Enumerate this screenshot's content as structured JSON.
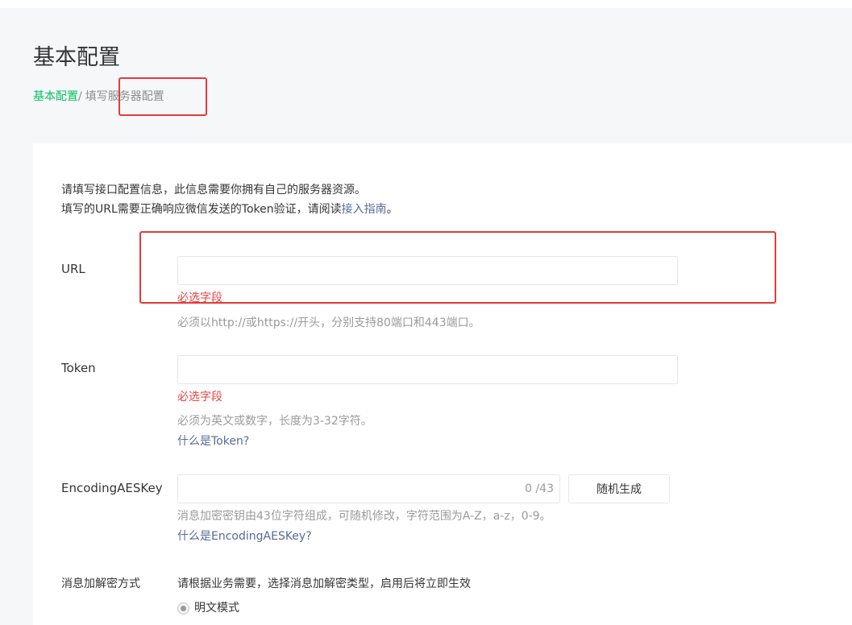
{
  "page": {
    "title": "基本配置",
    "breadcrumb": {
      "home": "基本配置",
      "separator": "/",
      "current": "填写服务器配置"
    }
  },
  "intro": {
    "line1": "请填写接口配置信息，此信息需要你拥有自己的服务器资源。",
    "line2_prefix": "填写的URL需要正确响应微信发送的Token验证，请阅读",
    "line2_link": "接入指南",
    "line2_suffix": "。"
  },
  "form": {
    "url": {
      "label": "URL",
      "value": "",
      "error": "必选字段",
      "tip": "必须以http://或https://开头，分别支持80端口和443端口。"
    },
    "token": {
      "label": "Token",
      "value": "",
      "error": "必选字段",
      "tip": "必须为英文或数字，长度为3-32字符。",
      "help_link": "什么是Token?"
    },
    "aes_key": {
      "label": "EncodingAESKey",
      "value": "",
      "counter": "0 /43",
      "generate_button": "随机生成",
      "tip": "消息加密密钥由43位字符组成，可随机修改，字符范围为A-Z，a-z，0-9。",
      "help_link": "什么是EncodingAESKey?"
    },
    "encrypt_mode": {
      "label": "消息加解密方式",
      "description": "请根据业务需要，选择消息加解密类型，启用后将立即生效",
      "options": [
        {
          "label": "明文模式",
          "selected": true
        }
      ]
    }
  },
  "colors": {
    "brand_green": "#07c160",
    "link_blue": "#576b95",
    "error_red": "#e64340",
    "annotation_red": "#e33b3b"
  }
}
